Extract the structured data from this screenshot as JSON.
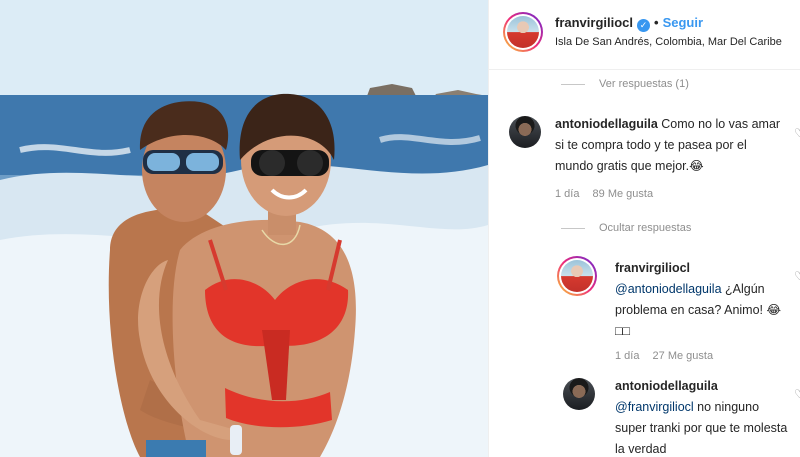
{
  "post": {
    "username": "franvirgiliocl",
    "verified_icon": "verified-badge-icon",
    "follow_label": "Seguir",
    "separator": "•",
    "location": "Isla De San Andrés, Colombia, Mar Del Caribe"
  },
  "comments": {
    "view_replies_label": "Ver respuestas (1)",
    "hide_replies_label": "Ocultar respuestas",
    "items": [
      {
        "username": "antoniodellaguila",
        "text": "Como no lo vas amar si te compra todo y te pasea por el mundo gratis que mejor.😂",
        "age": "1 día",
        "likes": "89 Me gusta"
      }
    ],
    "replies": [
      {
        "username": "franvirgiliocl",
        "mention": "@antoniodellaguila",
        "text": "¿Algún problema en casa? Animo! 😂□□",
        "age": "1 día",
        "likes": "27 Me gusta"
      },
      {
        "username": "antoniodellaguila",
        "mention": "@franvirgiliocl",
        "text": "no ninguno super tranki por que te molesta la verdad"
      }
    ]
  },
  "colors": {
    "link_blue": "#3897f0",
    "mention_blue": "#00376b",
    "muted_gray": "#8e8e8e",
    "text": "#262626"
  }
}
